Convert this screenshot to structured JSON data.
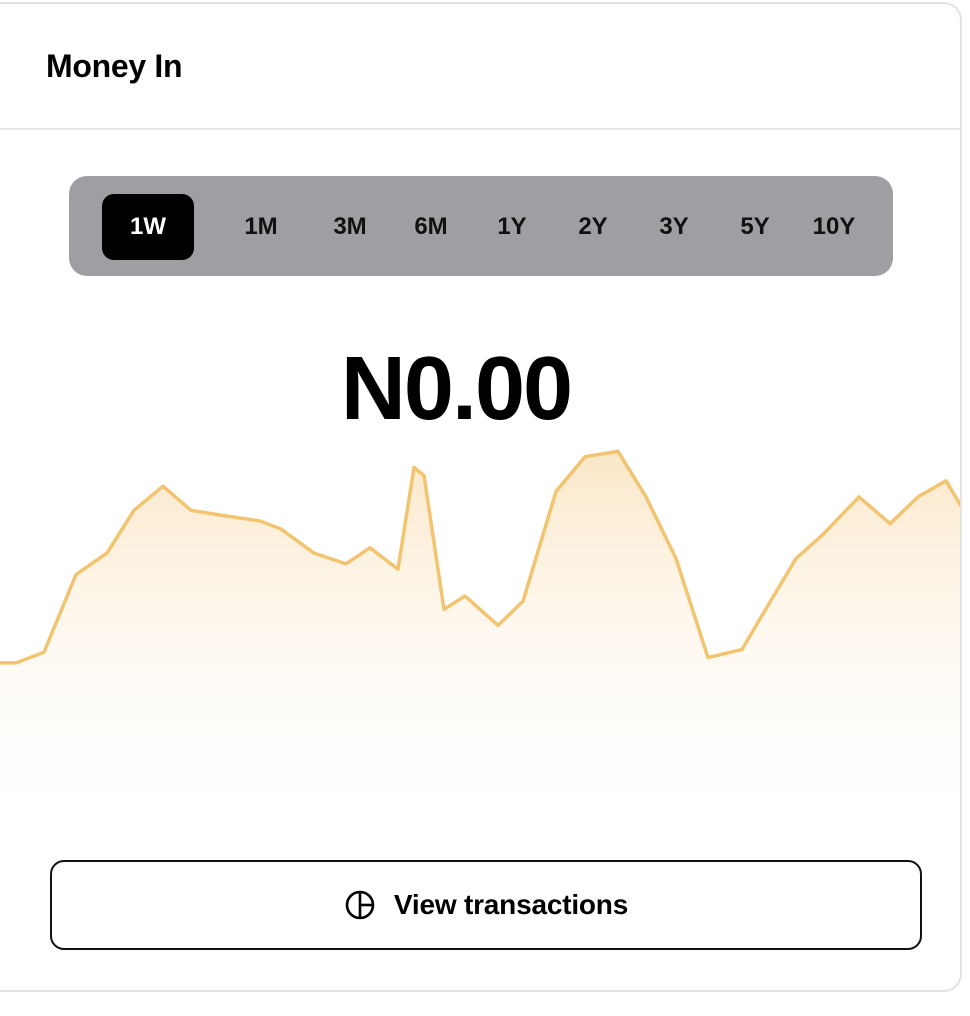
{
  "card": {
    "title": "Money In"
  },
  "ranges": [
    {
      "label": "1W",
      "active": true
    },
    {
      "label": "1M",
      "active": false
    },
    {
      "label": "3M",
      "active": false
    },
    {
      "label": "6M",
      "active": false
    },
    {
      "label": "1Y",
      "active": false
    },
    {
      "label": "2Y",
      "active": false
    },
    {
      "label": "3Y",
      "active": false
    },
    {
      "label": "5Y",
      "active": false
    },
    {
      "label": "10Y",
      "active": false
    }
  ],
  "amount": "N0.00",
  "chart_data": {
    "type": "area",
    "color": "#f3c46f",
    "values": [
      34,
      34,
      38,
      67,
      75,
      91,
      100,
      91,
      89,
      87,
      84,
      75,
      71,
      77,
      69,
      107,
      104,
      54,
      59,
      48,
      57,
      98,
      111,
      113,
      96,
      73,
      36,
      39,
      53,
      73,
      82,
      96,
      86,
      96,
      102,
      92
    ]
  },
  "view_button": {
    "label": "View transactions",
    "icon": "pie-chart-icon"
  }
}
